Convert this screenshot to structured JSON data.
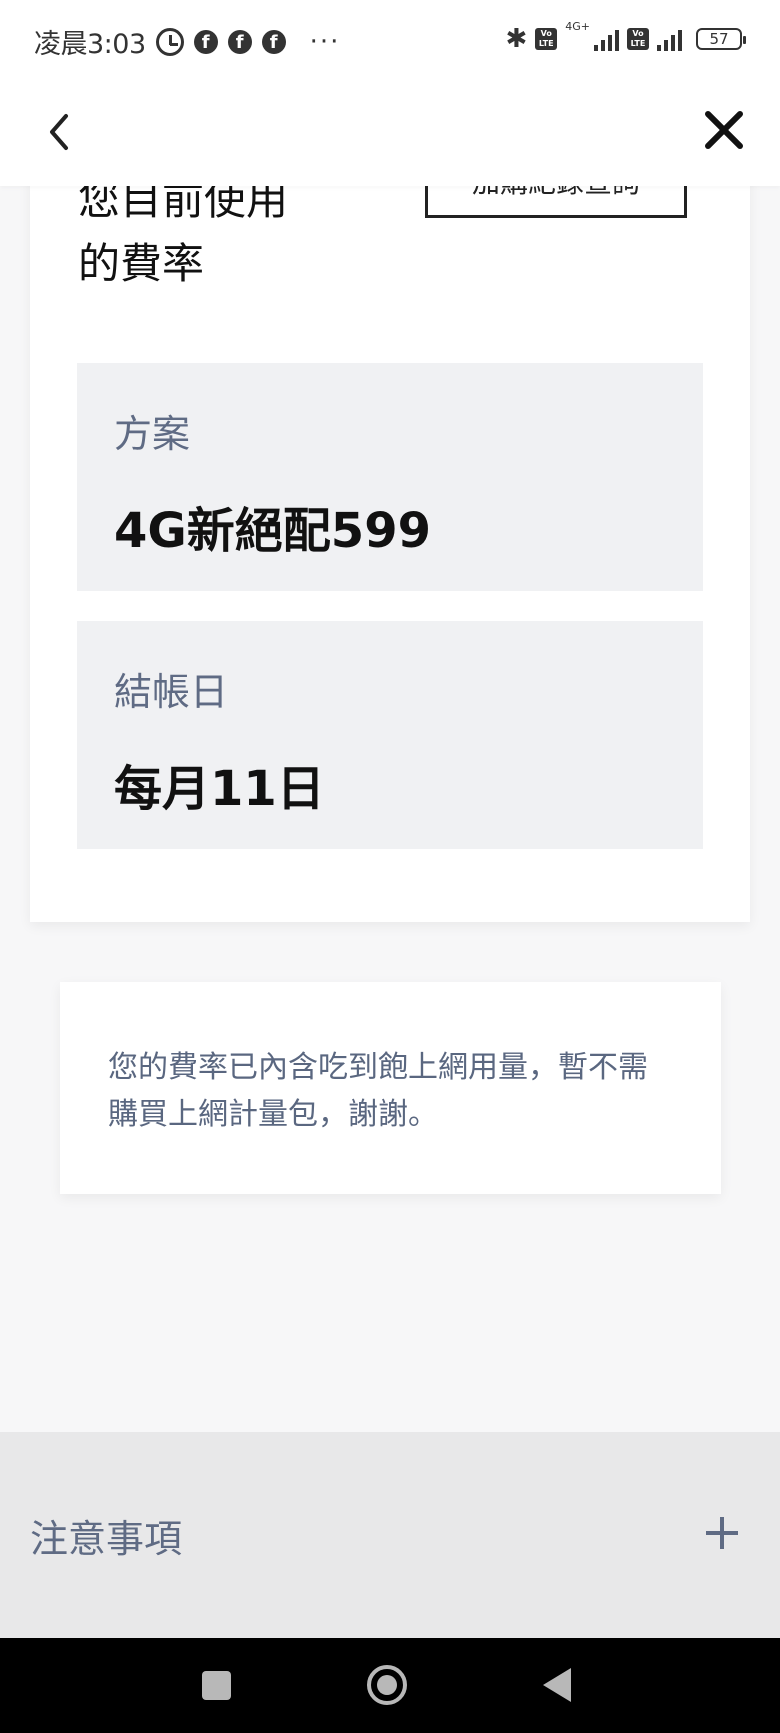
{
  "status_bar": {
    "time": "凌晨3:03",
    "more": "···",
    "network_label": "4G+",
    "volte_label": "Vo LTE",
    "battery": "57",
    "icons": [
      "alarm-icon",
      "facebook-icon",
      "facebook-icon",
      "facebook-icon",
      "bluetooth-icon",
      "volte-icon",
      "signal-icon",
      "volte-icon",
      "signal-icon",
      "battery-icon"
    ]
  },
  "nav": {
    "back_icon": "chevron-left-icon",
    "close_icon": "close-icon"
  },
  "plan_card": {
    "heading_line1": "您目前使用",
    "heading_line2": "的費率",
    "history_button": "加購紀錄查詢",
    "plan_label": "方案",
    "plan_value": "4G新絕配599",
    "billing_label": "結帳日",
    "billing_value": "每月11日"
  },
  "notice": {
    "text": "您的費率已內含吃到飽上網用量，暫不需購買上網計量包，謝謝。"
  },
  "accordion": {
    "title": "注意事項",
    "icon": "plus-icon"
  },
  "colors": {
    "label_text": "#5f6b84",
    "box_bg": "#f0f1f3",
    "page_bg": "#f7f7f8",
    "accordion_bg": "#e8e8e9"
  }
}
